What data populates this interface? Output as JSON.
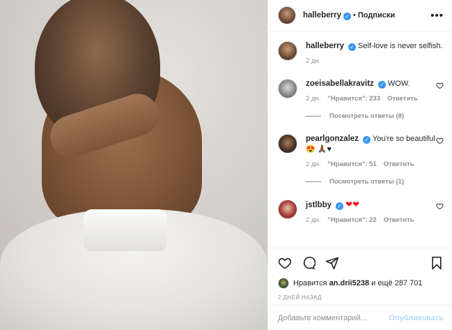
{
  "header": {
    "username": "halleberry",
    "separator": "•",
    "follow_status": "Подписки",
    "more": "•••"
  },
  "caption": {
    "username": "halleberry",
    "text": "Self-love is never selfish.",
    "age": "2 дн."
  },
  "comments": [
    {
      "username": "zoeisabellakravitz",
      "text": "WOW.",
      "age": "2 дн.",
      "likes": "\"Нравится\": 233",
      "reply": "Ответить",
      "view_replies": "Посмотреть ответы (8)"
    },
    {
      "username": "pearlgonzalez",
      "text": "You're so beautiful 😍 🙏🏾♥",
      "age": "2 дн.",
      "likes": "\"Нравится\": 51",
      "reply": "Ответить",
      "view_replies": "Посмотреть ответы (1)"
    },
    {
      "username": "jstlbby",
      "text": "❤❤",
      "age": "2 дн.",
      "likes": "\"Нравится\": 22",
      "reply": "Ответить"
    }
  ],
  "likes": {
    "prefix": "Нравится",
    "user": "an.drii5238",
    "suffix": "и ещё 287 701"
  },
  "time_ago": "2 ДНЕЙ НАЗАД",
  "add_comment": {
    "placeholder": "Добавьте комментарий...",
    "post_label": "Опубликовать"
  },
  "icons": [
    "heart-icon",
    "comment-icon",
    "share-icon",
    "bookmark-icon"
  ]
}
